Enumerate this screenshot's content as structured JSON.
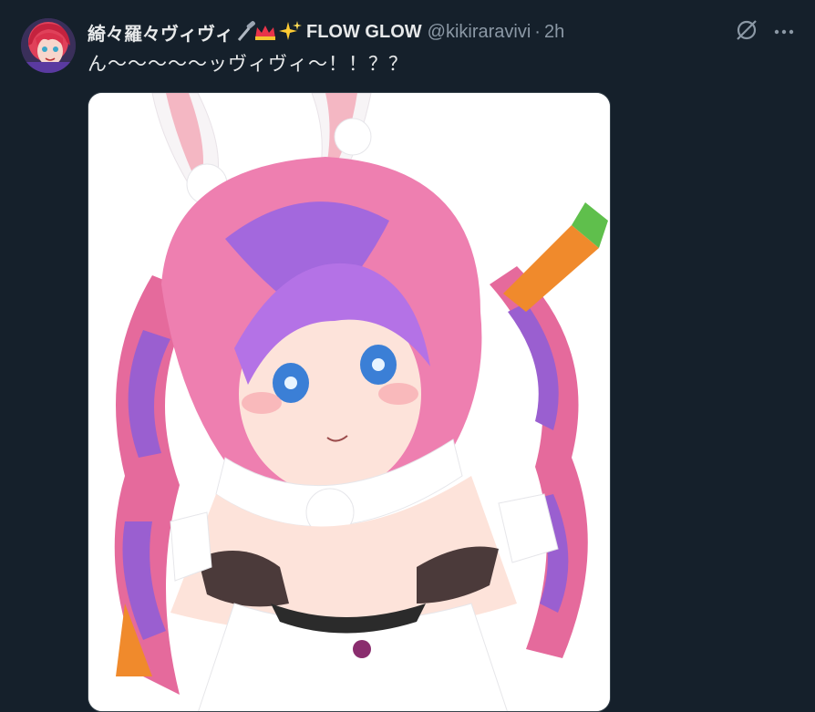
{
  "tweet": {
    "display_name": "綺々羅々ヴィヴィ",
    "name_suffix": "FLOW GLOW",
    "handle": "@kikiraravivi",
    "separator": "·",
    "time": "2h",
    "text": "ん〜〜〜〜〜ッヴィヴィ〜！！？？"
  },
  "icons": {
    "header_emojis": [
      "microphone-icon",
      "crown-icon",
      "sparkles-icon"
    ],
    "grok": "grok-icon",
    "more": "more-icon"
  },
  "colors": {
    "background": "#15202b",
    "text_primary": "#e7e9ea",
    "text_secondary": "#8b98a5"
  }
}
